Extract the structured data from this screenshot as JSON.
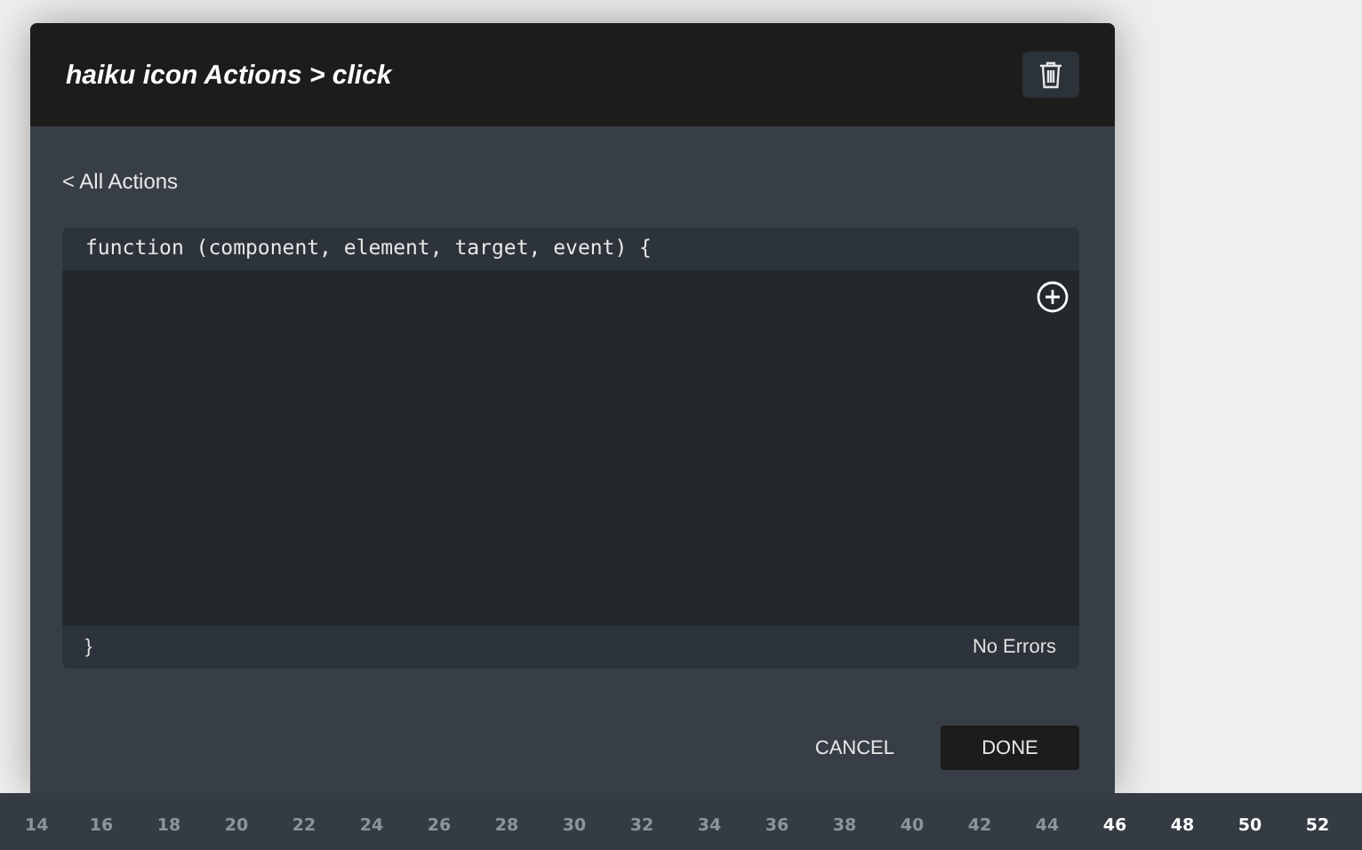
{
  "modal": {
    "title": "haiku icon Actions > click",
    "back_link": "< All Actions",
    "editor": {
      "signature": "function (component, element, target, event) {",
      "closing": "}",
      "status": "No Errors"
    },
    "buttons": [
      {
        "label": "CANCEL",
        "kind": "text"
      },
      {
        "label": "DONE",
        "kind": "primary"
      }
    ]
  },
  "timeline": {
    "ticks": [
      {
        "label": "14",
        "highlighted": false
      },
      {
        "label": "16",
        "highlighted": false
      },
      {
        "label": "18",
        "highlighted": false
      },
      {
        "label": "20",
        "highlighted": false
      },
      {
        "label": "22",
        "highlighted": false
      },
      {
        "label": "24",
        "highlighted": false
      },
      {
        "label": "26",
        "highlighted": false
      },
      {
        "label": "28",
        "highlighted": false
      },
      {
        "label": "30",
        "highlighted": false
      },
      {
        "label": "32",
        "highlighted": false
      },
      {
        "label": "34",
        "highlighted": false
      },
      {
        "label": "36",
        "highlighted": false
      },
      {
        "label": "38",
        "highlighted": false
      },
      {
        "label": "40",
        "highlighted": false
      },
      {
        "label": "42",
        "highlighted": false
      },
      {
        "label": "44",
        "highlighted": false
      },
      {
        "label": "46",
        "highlighted": true
      },
      {
        "label": "48",
        "highlighted": true
      },
      {
        "label": "50",
        "highlighted": true
      },
      {
        "label": "52",
        "highlighted": true
      }
    ]
  }
}
